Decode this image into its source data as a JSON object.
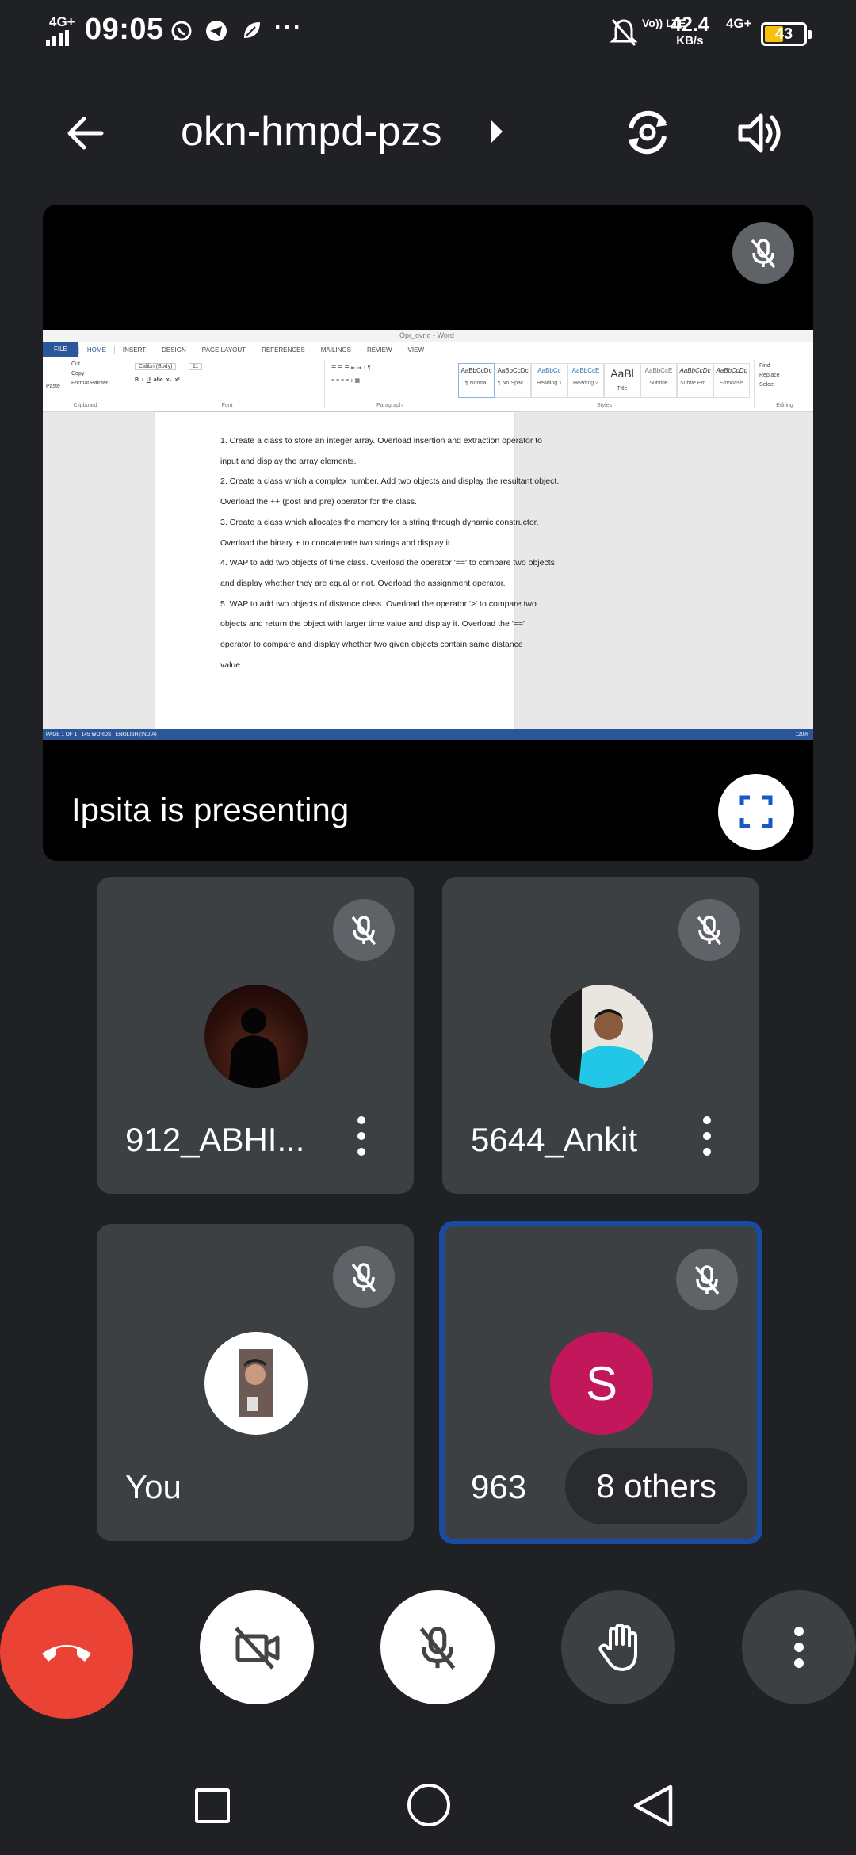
{
  "status_bar": {
    "network_type": "4G+",
    "time": "09:05",
    "apps": [
      "whatsapp-icon",
      "telegram-icon",
      "leaf-icon"
    ],
    "overflow": "···",
    "volte": "Vo)) LTE",
    "speed_value": "42.4",
    "speed_unit": "KB/s",
    "network_type_right": "4G+",
    "battery_level": "43",
    "battery_color": "#f4c20d"
  },
  "header": {
    "meeting_code": "okn-hmpd-pzs"
  },
  "presentation": {
    "presenter_label": "Ipsita is presenting",
    "word": {
      "window_title": "Opr_ovrld - Word",
      "tabs": [
        "FILE",
        "HOME",
        "INSERT",
        "DESIGN",
        "PAGE LAYOUT",
        "REFERENCES",
        "MAILINGS",
        "REVIEW",
        "VIEW"
      ],
      "clipboard": {
        "paste": "Paste",
        "cut": "Cut",
        "copy": "Copy",
        "format_painter": "Format Painter",
        "caption": "Clipboard"
      },
      "font": {
        "name": "Calibri (Body)",
        "size": "11",
        "caption": "Font"
      },
      "paragraph_caption": "Paragraph",
      "styles": [
        {
          "preview": "AaBbCcDc",
          "name": "¶ Normal"
        },
        {
          "preview": "AaBbCcDc",
          "name": "¶ No Spac..."
        },
        {
          "preview": "AaBbCc",
          "name": "Heading 1"
        },
        {
          "preview": "AaBbCcE",
          "name": "Heading 2"
        },
        {
          "preview": "AaBl",
          "name": "Title"
        },
        {
          "preview": "AaBbCcE",
          "name": "Subtitle"
        },
        {
          "preview": "AaBbCcDc",
          "name": "Subtle Em..."
        },
        {
          "preview": "AaBbCcDc",
          "name": "Emphasis"
        }
      ],
      "styles_caption": "Styles",
      "editing": {
        "find": "Find",
        "replace": "Replace",
        "select": "Select",
        "caption": "Editing"
      },
      "document_lines": [
        "1. Create a class to store an integer array. Overload insertion and extraction operator to",
        "input and display the array elements.",
        "2. Create a class which a complex number. Add two objects and display the resultant object.",
        "Overload the ++ (post and pre) operator for the class.",
        "3. Create a class which allocates the memory for a string through dynamic constructor.",
        "Overload the binary + to concatenate two strings and display it.",
        "4. WAP to add two objects of time class. Overload the operator '==' to compare two objects",
        "and display whether they are equal or not. Overload the assignment operator.",
        "5. WAP to add two objects of distance class. Overload the operator '>' to compare two",
        "objects and return the object with larger time value and display it. Overload the '=='",
        "operator to compare and display whether two given objects contain same distance",
        "value."
      ],
      "status": {
        "page": "PAGE 1 OF 1",
        "words": "145 WORDS",
        "language": "ENGLISH (INDIA)",
        "zoom": "120%"
      }
    }
  },
  "participants": [
    {
      "name": "912_ABHI...",
      "avatar": "silhouette-photo"
    },
    {
      "name": "5644_Ankit",
      "avatar": "person-photo"
    },
    {
      "name": "You",
      "avatar": "self-photo"
    },
    {
      "name": "963",
      "avatar_letter": "S",
      "avatar_color": "#c2185b",
      "others_label": "8 others",
      "active_border_color": "#1a4ba3"
    }
  ],
  "controls": {
    "end_call_color": "#ea4335",
    "icons": [
      "end-call-icon",
      "camera-off-icon",
      "mic-off-icon",
      "raise-hand-icon",
      "more-vert-icon"
    ]
  },
  "nav": {
    "icons": [
      "recents-icon",
      "home-icon",
      "back-icon"
    ]
  }
}
